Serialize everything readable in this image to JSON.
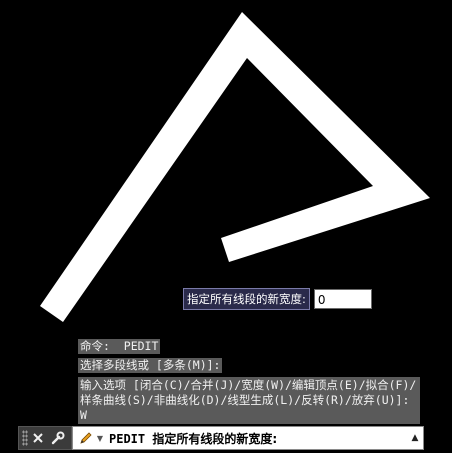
{
  "drawing": {
    "shape_color": "#ffffff",
    "background_color": "#000000"
  },
  "dynamic_input": {
    "prompt": "指定所有线段的新宽度:",
    "value": "0"
  },
  "command_history": [
    "命令:  PEDIT",
    "选择多段线或 [多条(M)]:",
    "输入选项 [闭合(C)/合并(J)/宽度(W)/编辑顶点(E)/拟合(F)/样条曲线(S)/非曲线化(D)/线型生成(L)/反转(R)/放弃(U)]: W"
  ],
  "command_line": {
    "command": "PEDIT",
    "prompt": "指定所有线段的新宽度:",
    "icons": [
      "close-icon",
      "wrench-icon",
      "pencil-icon",
      "chevron-down-icon",
      "chevron-up-icon"
    ]
  }
}
